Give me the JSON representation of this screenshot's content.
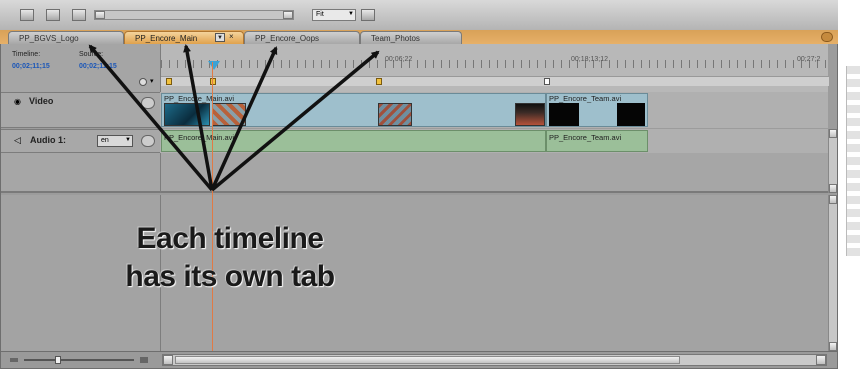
{
  "toolbar": {
    "zoom_value": "Fit"
  },
  "tabs": [
    {
      "label": "PP_BGVS_Logo",
      "active": false
    },
    {
      "label": "PP_Encore_Main",
      "active": true
    },
    {
      "label": "PP_Encore_Oops",
      "active": false
    },
    {
      "label": "Team_Photos",
      "active": false
    }
  ],
  "timecodes": {
    "timeline_label": "Timeline:",
    "timeline_value": "00;02;11;15",
    "source_label": "Source:",
    "source_value": "00;02;11;15"
  },
  "ruler": {
    "marks": [
      "00;06;22",
      "00;18;13;12",
      "00;27;2"
    ]
  },
  "tracks": {
    "video_label": "Video",
    "audio_label": "Audio 1:",
    "audio_channel": "en"
  },
  "clips": {
    "video_main": "PP_Encore_Main.avi",
    "video_team": "PP_Encore_Team.avi",
    "audio_main": "PP_Encore_Main.avi",
    "audio_team": "PP_Encore_Team.avi"
  },
  "annotation": {
    "line1": "Each timeline",
    "line2": "has its own tab"
  },
  "colors": {
    "active_tab": "#e0a24c",
    "timecode_blue": "#1a56b8",
    "playhead": "#e07a45",
    "video_clip": "#9ebfcc",
    "audio_clip": "#9bbf99"
  }
}
